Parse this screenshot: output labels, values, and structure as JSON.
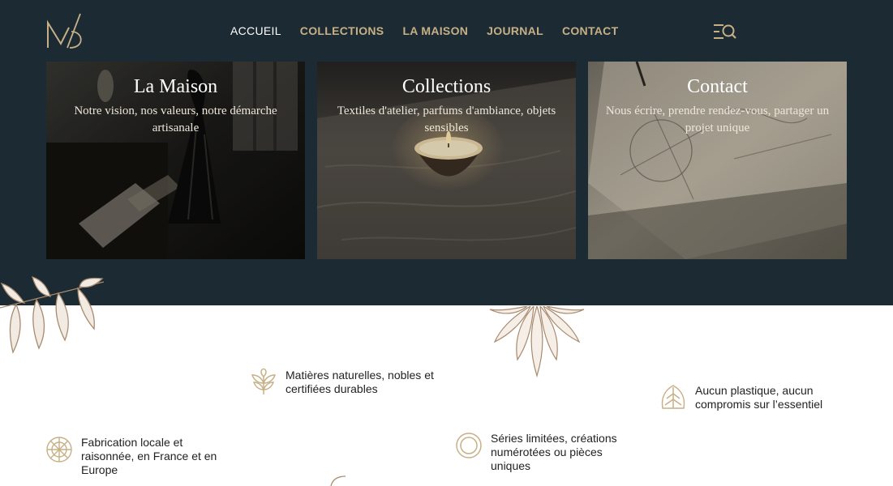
{
  "brand": {
    "logo_text": "MD",
    "accent": "#c7b086",
    "band_color": "#1c2a33"
  },
  "nav": {
    "items": [
      {
        "label": "ACCUEIL",
        "active": true
      },
      {
        "label": "COLLECTIONS",
        "active": false
      },
      {
        "label": "LA MAISON",
        "active": false
      },
      {
        "label": "JOURNAL",
        "active": false
      },
      {
        "label": "CONTACT",
        "active": false
      }
    ],
    "menu_icon": "menu-search-icon"
  },
  "cards": [
    {
      "title": "La Maison",
      "subtitle": "Notre vision, nos valeurs, notre démarche artisanale",
      "image": "dress-on-mannequin-photo"
    },
    {
      "title": "Collections",
      "subtitle": "Textiles d'atelier, parfums d'ambiance, objets sensibles",
      "image": "candle-on-wooden-table-photo"
    },
    {
      "title": "Contact",
      "subtitle": "Nous écrire, prendre rendez-vous, partager un projet unique",
      "image": "sketches-on-paper-photo"
    }
  ],
  "features": [
    {
      "icon": "sprout-icon",
      "text": "Matières naturelles, nobles et certifiées durables"
    },
    {
      "icon": "leaf-icon",
      "text": "Aucun plastique, aucun compromis sur l’essentiel"
    },
    {
      "icon": "wheel-icon",
      "text": "Fabrication locale et raisonnée, en France et en Europe"
    },
    {
      "icon": "ring-icon",
      "text": "Séries limitées, créations numérotées ou pièces uniques"
    }
  ]
}
